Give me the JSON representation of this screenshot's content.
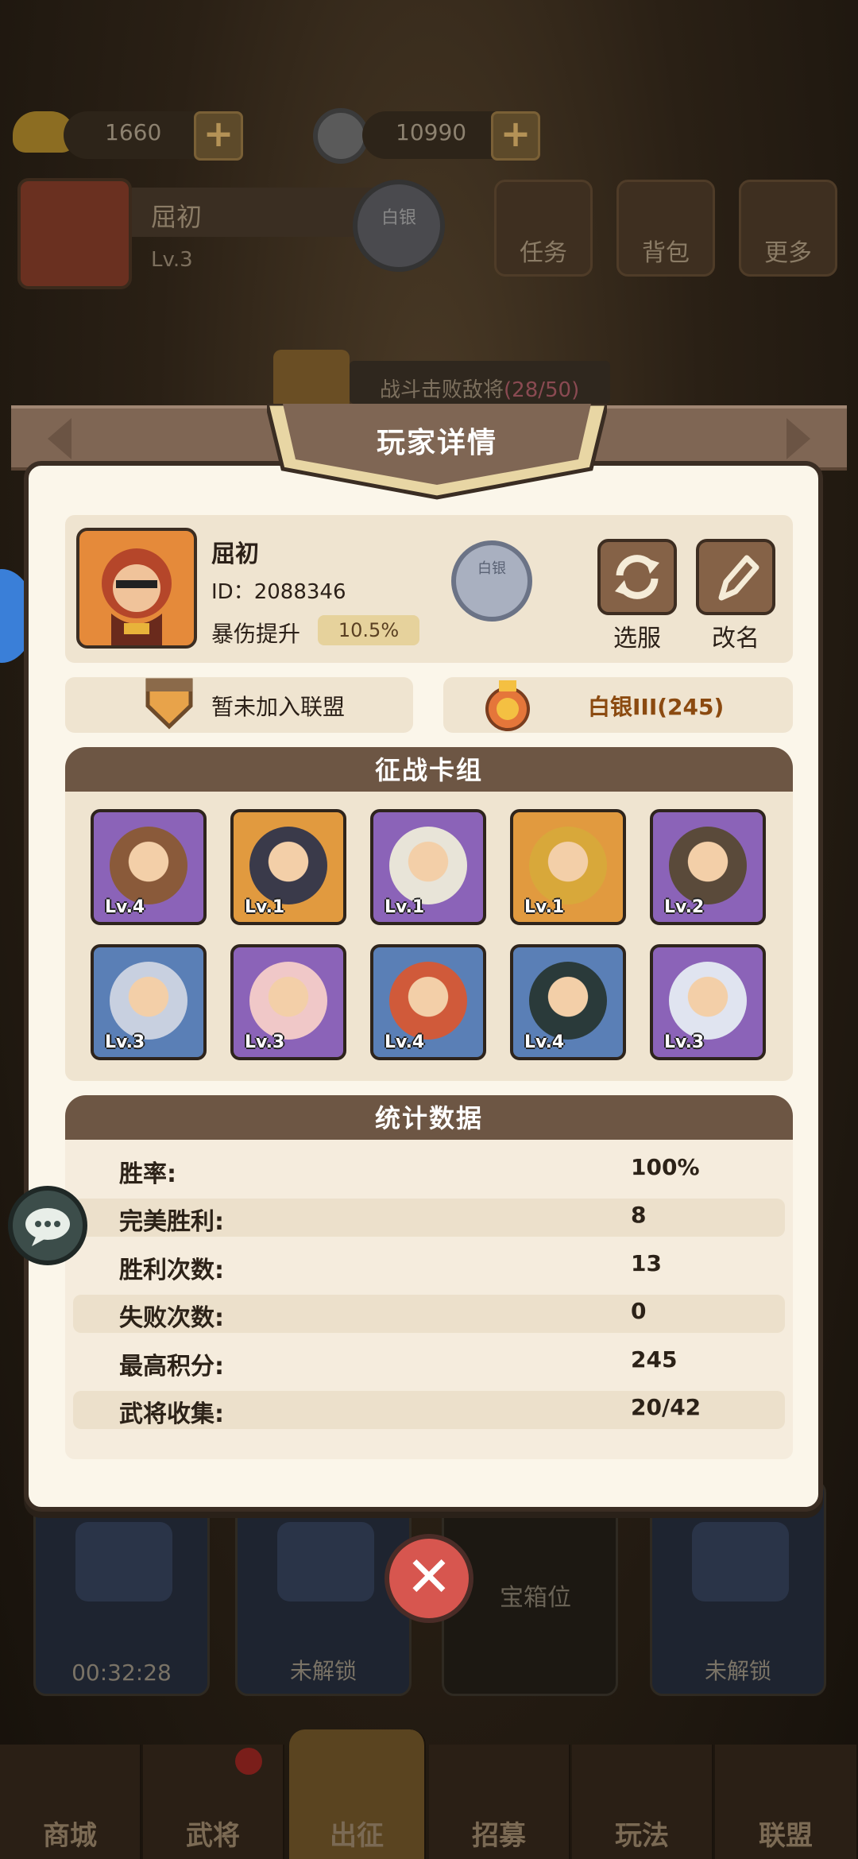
{
  "background": {
    "currency": {
      "ingot": "1660",
      "coin": "10990"
    },
    "player": {
      "name": "屈初",
      "level": "Lv.3",
      "rank_badge": "白银"
    },
    "top_buttons": [
      "任务",
      "背包",
      "更多"
    ],
    "quest_text": "战斗击败敌将",
    "quest_progress": "(28/50)",
    "chest_slots": [
      {
        "label": "00:32:28"
      },
      {
        "label": "未解锁"
      },
      {
        "label": "宝箱位"
      },
      {
        "label": "未解锁"
      }
    ],
    "bottom_nav": [
      "商城",
      "武将",
      "出征",
      "招募",
      "玩法",
      "联盟"
    ]
  },
  "dialog": {
    "title": "玩家详情",
    "player": {
      "name": "屈初",
      "id": "ID：2088346",
      "crit_label": "暴伤提升",
      "crit_value": "10.5%",
      "rank_badge": "白银"
    },
    "buttons": {
      "switch_server": "选服",
      "rename": "改名"
    },
    "alliance": "暂未加入联盟",
    "rank": "白银III(245)",
    "deck_title": "征战卡组",
    "cards": [
      {
        "level": "Lv.4",
        "rarity": "purple",
        "color": "#8a5a3a"
      },
      {
        "level": "Lv.1",
        "rarity": "orange",
        "color": "#3a3a4a"
      },
      {
        "level": "Lv.1",
        "rarity": "purple",
        "color": "#e8e4d8"
      },
      {
        "level": "Lv.1",
        "rarity": "orange",
        "color": "#d8a83a"
      },
      {
        "level": "Lv.2",
        "rarity": "purple",
        "color": "#5a4a3a"
      },
      {
        "level": "Lv.3",
        "rarity": "blue",
        "color": "#c8d0e0"
      },
      {
        "level": "Lv.3",
        "rarity": "purple",
        "color": "#f0c8c8"
      },
      {
        "level": "Lv.4",
        "rarity": "blue",
        "color": "#d05a3a"
      },
      {
        "level": "Lv.4",
        "rarity": "blue",
        "color": "#2a3a3a"
      },
      {
        "level": "Lv.3",
        "rarity": "purple",
        "color": "#e0e4f0"
      }
    ],
    "stats_title": "统计数据",
    "stats": [
      {
        "label": "胜率:",
        "value": "100%"
      },
      {
        "label": "完美胜利:",
        "value": "8"
      },
      {
        "label": "胜利次数:",
        "value": "13"
      },
      {
        "label": "失败次数:",
        "value": "0"
      },
      {
        "label": "最高积分:",
        "value": "245"
      },
      {
        "label": "武将收集:",
        "value": "20/42"
      }
    ]
  },
  "colors": {
    "dialog_bg": "#fbf6ea",
    "header_brown": "#6d5644",
    "accent_gold": "#e8d6a4"
  }
}
